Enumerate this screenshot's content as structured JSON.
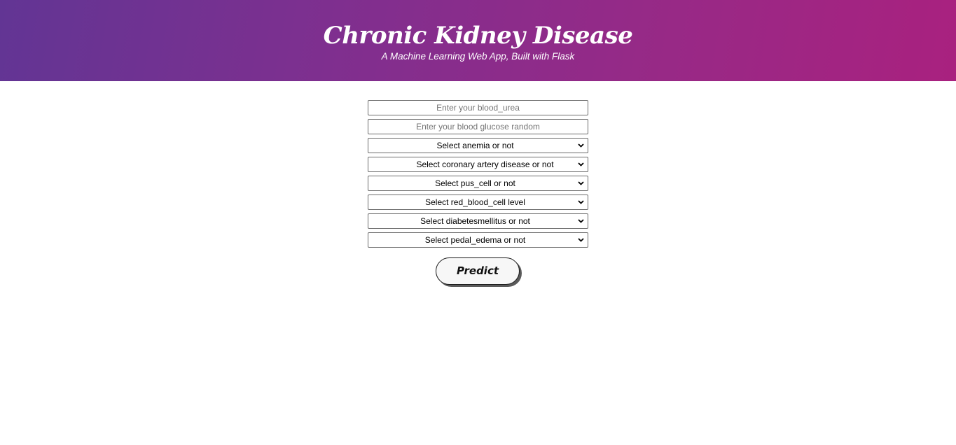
{
  "header": {
    "title": "Chronic Kidney Disease",
    "subtitle": "A Machine Learning Web App, Built with Flask",
    "gradient_start": "#623594",
    "gradient_end": "#a9217f"
  },
  "form": {
    "inputs": [
      {
        "placeholder": "Enter your blood_urea"
      },
      {
        "placeholder": "Enter your blood glucose random"
      }
    ],
    "selects": [
      {
        "selected": "Select anemia or not"
      },
      {
        "selected": "Select coronary artery disease or not"
      },
      {
        "selected": "Select pus_cell or not"
      },
      {
        "selected": "Select red_blood_cell level"
      },
      {
        "selected": "Select diabetesmellitus or not"
      },
      {
        "selected": "Select pedal_edema or not"
      }
    ],
    "submit_label": "Predict"
  },
  "icons": {
    "select_arrow": "chevron-down-icon"
  }
}
